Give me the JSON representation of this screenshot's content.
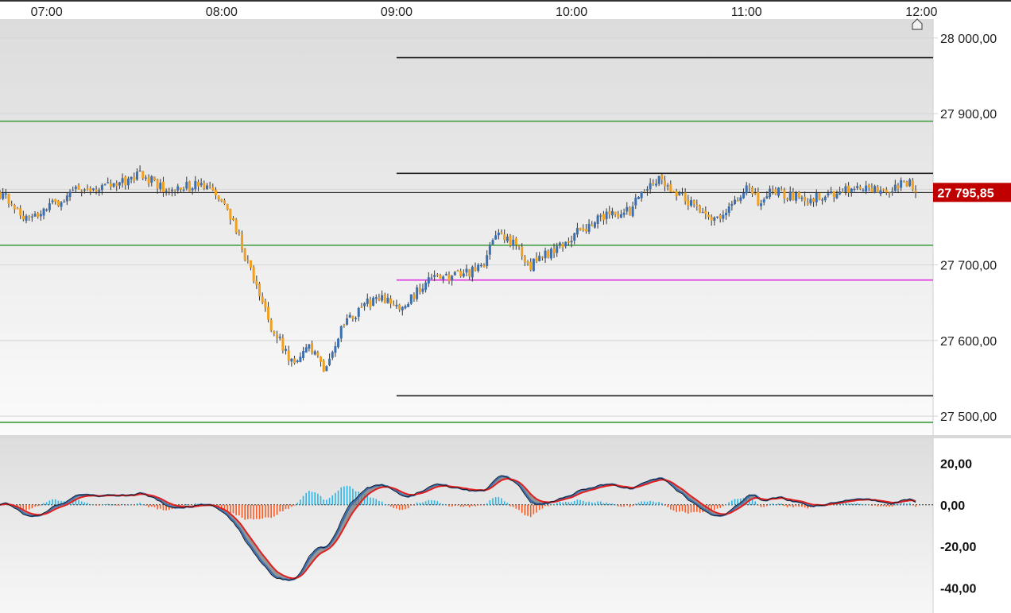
{
  "chart_data": [
    {
      "type": "candlestick",
      "title": "",
      "x_ticks": [
        "07:00",
        "08:00",
        "09:00",
        "10:00",
        "11:00",
        "12:00"
      ],
      "x_range": [
        "06:44",
        "12:04"
      ],
      "y_ticks": [
        "28 000,00",
        "27 900,00",
        "27 800,00",
        "27 700,00",
        "27 600,00",
        "27 500,00"
      ],
      "y_tick_values": [
        28000,
        27900,
        27800,
        27700,
        27600,
        27500
      ],
      "ylim": [
        27475,
        28025
      ],
      "grid": "horizontal",
      "last_price": 27795.85,
      "last_price_label": "27 795,85",
      "colors": {
        "up": "#3c6fb0",
        "down": "#f0a020",
        "last_price_bg": "#c00000"
      },
      "horizontal_lines": [
        {
          "price": 27890,
          "color": "#3a9a3a",
          "from": "06:44"
        },
        {
          "price": 27726,
          "color": "#3a9a3a",
          "from": "06:44"
        },
        {
          "price": 27492,
          "color": "#3a9a3a",
          "from": "06:44"
        },
        {
          "price": 27795.85,
          "color": "#222222",
          "from": "06:44"
        },
        {
          "price": 27974,
          "color": "#222222",
          "from": "09:00"
        },
        {
          "price": 27821,
          "color": "#222222",
          "from": "09:00"
        },
        {
          "price": 27680,
          "color": "#e030e0",
          "from": "09:00"
        },
        {
          "price": 27527,
          "color": "#222222",
          "from": "09:00"
        }
      ],
      "price_path_keypoints": [
        {
          "t": "06:44",
          "p": 27795
        },
        {
          "t": "06:54",
          "p": 27760
        },
        {
          "t": "07:10",
          "p": 27800
        },
        {
          "t": "07:24",
          "p": 27805
        },
        {
          "t": "07:33",
          "p": 27820
        },
        {
          "t": "07:40",
          "p": 27800
        },
        {
          "t": "07:53",
          "p": 27805
        },
        {
          "t": "07:57",
          "p": 27795
        },
        {
          "t": "08:04",
          "p": 27760
        },
        {
          "t": "08:10",
          "p": 27690
        },
        {
          "t": "08:17",
          "p": 27620
        },
        {
          "t": "08:25",
          "p": 27565
        },
        {
          "t": "08:30",
          "p": 27590
        },
        {
          "t": "08:35",
          "p": 27565
        },
        {
          "t": "08:42",
          "p": 27620
        },
        {
          "t": "08:50",
          "p": 27650
        },
        {
          "t": "08:57",
          "p": 27655
        },
        {
          "t": "09:02",
          "p": 27640
        },
        {
          "t": "09:10",
          "p": 27680
        },
        {
          "t": "09:20",
          "p": 27685
        },
        {
          "t": "09:29",
          "p": 27695
        },
        {
          "t": "09:35",
          "p": 27745
        },
        {
          "t": "09:41",
          "p": 27725
        },
        {
          "t": "09:46",
          "p": 27700
        },
        {
          "t": "09:56",
          "p": 27725
        },
        {
          "t": "10:10",
          "p": 27765
        },
        {
          "t": "10:20",
          "p": 27770
        },
        {
          "t": "10:25",
          "p": 27800
        },
        {
          "t": "10:30",
          "p": 27815
        },
        {
          "t": "10:40",
          "p": 27785
        },
        {
          "t": "10:50",
          "p": 27760
        },
        {
          "t": "11:00",
          "p": 27800
        },
        {
          "t": "11:05",
          "p": 27780
        },
        {
          "t": "11:08",
          "p": 27800
        },
        {
          "t": "11:20",
          "p": 27785
        },
        {
          "t": "11:35",
          "p": 27800
        },
        {
          "t": "11:48",
          "p": 27800
        },
        {
          "t": "11:56",
          "p": 27810
        },
        {
          "t": "11:58",
          "p": 27796
        }
      ]
    },
    {
      "type": "line",
      "title": "",
      "y_ticks": [
        "20,00",
        "0,00",
        "-20,00",
        "-40,00"
      ],
      "y_tick_values": [
        20,
        0,
        -20,
        -40
      ],
      "ylim": [
        -52,
        32
      ],
      "series": [
        {
          "name": "",
          "color": "#3c6fb0"
        },
        {
          "name": "",
          "color": "#e02020"
        },
        {
          "name": "",
          "color": "#111111"
        }
      ],
      "histogram_colors": {
        "positive": "#29b6e6",
        "negative": "#ff5a1f"
      },
      "zero_line": true
    }
  ]
}
